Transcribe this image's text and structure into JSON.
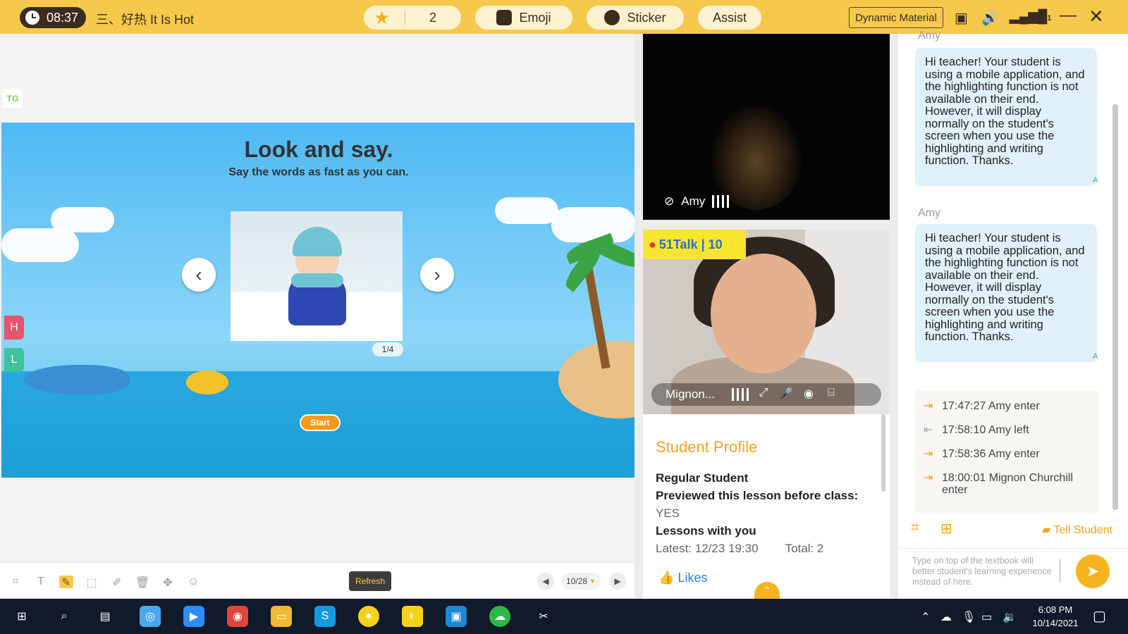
{
  "topbar": {
    "timer": "08:37",
    "lesson_title": "三、好热 It Is Hot",
    "stars_count": "2",
    "emoji_label": "Emoji",
    "sticker_label": "Sticker",
    "assist_label": "Assist",
    "dynamic_material_label": "Dynamic Material",
    "signal_level": "1",
    "accent_color": "#f6c94c"
  },
  "whiteboard": {
    "tg_label": "TG",
    "slide_title": "Look and say.",
    "slide_subtitle": "Say the words as fast as you can.",
    "slide_pager": "1/4",
    "start_label": "Start",
    "h_label": "H",
    "l_label": "L",
    "refresh_label": "Refresh",
    "page_indicator": "10/28"
  },
  "video": {
    "student_name": "Amy",
    "teacher_name": "Mignon...",
    "brand_badge": "51Talk | 10"
  },
  "profile": {
    "title": "Student Profile",
    "student_type": "Regular Student",
    "previewed_label": "Previewed this lesson before class:",
    "previewed_value": "YES",
    "lessons_label": "Lessons with you",
    "latest_label": "Latest: 12/23 19:30",
    "total_label": "Total: 2",
    "likes_label": "Likes"
  },
  "chat": {
    "messages": [
      {
        "sender": "Amy",
        "text": "Hi teacher! Your student is using a mobile application, and the highlighting function is not available on their end. However, it will display normally on the student's screen when you use the highlighting and writing function. Thanks."
      },
      {
        "sender": "Amy",
        "text": "Hi teacher! Your student is using a mobile application, and the highlighting function is not available on their end. However, it will display normally on the student's screen when you use the highlighting and writing function. Thanks."
      }
    ],
    "events": [
      {
        "text": "17:47:27 Amy enter",
        "type": "enter"
      },
      {
        "text": "17:58:10 Amy left",
        "type": "left"
      },
      {
        "text": "17:58:36 Amy enter",
        "type": "enter"
      },
      {
        "text": "18:00:01 Mignon Churchill enter",
        "type": "enter"
      }
    ],
    "tell_student_label": "Tell Student",
    "input_placeholder": "Type on top of the textbook will better student's learning experience instead of here."
  },
  "taskbar": {
    "time": "6:08 PM",
    "date": "10/14/2021"
  }
}
